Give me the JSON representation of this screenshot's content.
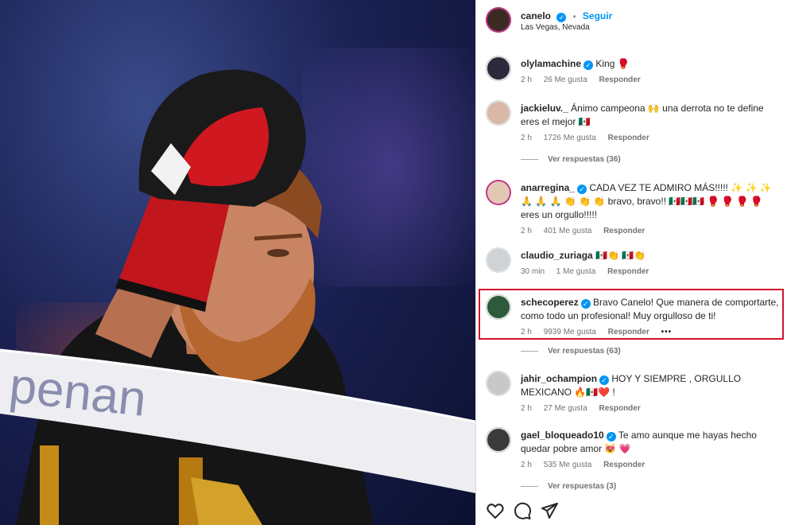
{
  "post": {
    "author": "canelo",
    "dot": "•",
    "follow_label": "Seguir",
    "location": "Las Vegas, Nevada"
  },
  "comments": [
    {
      "user": "olylamachine",
      "verified": true,
      "text": "King 🥊",
      "time": "2 h",
      "likes": "26 Me gusta",
      "reply": "Responder"
    },
    {
      "user": "jackieluv._",
      "verified": false,
      "text": "Ánimo campeona 🙌 una derrota no te define eres el mejor 🇲🇽",
      "time": "2 h",
      "likes": "1726 Me gusta",
      "reply": "Responder",
      "view_replies": "Ver respuestas (36)"
    },
    {
      "user": "anarregina_",
      "verified": true,
      "text": "CADA VEZ TE ADMIRO MÁS!!!!! ✨ ✨ ✨ 🙏 🙏 🙏 👏 👏 👏 bravo, bravo!! 🇲🇽🇲🇽🇲🇽 🥊 🥊 🥊 🥊 eres un orgullo!!!!!",
      "time": "2 h",
      "likes": "401 Me gusta",
      "reply": "Responder"
    },
    {
      "user": "claudio_zuriaga",
      "verified": false,
      "text": "🇲🇽👏 🇲🇽👏",
      "time": "30 min",
      "likes": "1 Me gusta",
      "reply": "Responder"
    },
    {
      "user": "schecoperez",
      "verified": true,
      "text": "Bravo Canelo! Que manera de comportarte, como todo un profesional! Muy orgulloso de ti!",
      "time": "2 h",
      "likes": "9939 Me gusta",
      "reply": "Responder",
      "more": "•••",
      "view_replies": "Ver respuestas (63)"
    },
    {
      "user": "jahir_ochampion",
      "verified": true,
      "text": "HOY Y SIEMPRE , ORGULLO MEXICANO 🔥🇲🇽❤️ !",
      "time": "2 h",
      "likes": "27 Me gusta",
      "reply": "Responder"
    },
    {
      "user": "gael_bloqueado10",
      "verified": true,
      "text": "Te amo aunque me hayas hecho quedar pobre amor 😻 💗",
      "time": "2 h",
      "likes": "535 Me gusta",
      "reply": "Responder",
      "view_replies": "Ver respuestas (3)"
    }
  ],
  "actions": {
    "like_icon": "heart-icon",
    "comment_icon": "comment-icon",
    "share_icon": "send-icon"
  },
  "colors": {
    "accent": "#0095f6",
    "highlight": "#d2142a"
  }
}
